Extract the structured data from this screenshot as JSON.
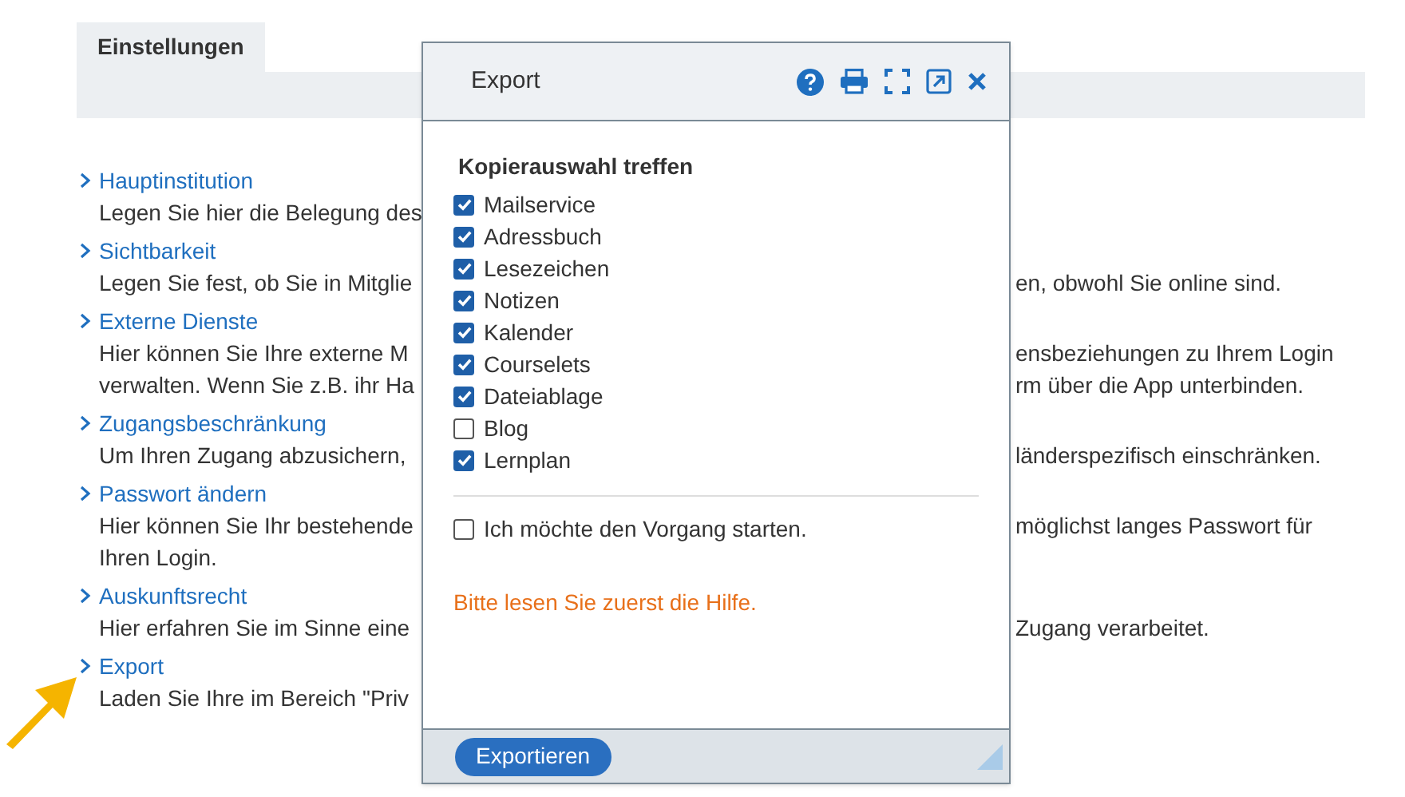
{
  "page_tab": "Einstellungen",
  "items": [
    {
      "title": "Hauptinstitution",
      "lines": [
        {
          "left": "Legen Sie hier die Belegung des"
        }
      ]
    },
    {
      "title": "Sichtbarkeit",
      "lines": [
        {
          "left": "Legen Sie fest, ob Sie in Mitglie",
          "right": "en, obwohl Sie online sind."
        }
      ]
    },
    {
      "title": "Externe Dienste",
      "lines": [
        {
          "left": "Hier können Sie Ihre externe M",
          "right": "ensbeziehungen zu Ihrem Login"
        },
        {
          "left": "verwalten. Wenn Sie z.B. ihr Ha",
          "right": "rm über die App unterbinden."
        }
      ]
    },
    {
      "title": "Zugangsbeschränkung",
      "lines": [
        {
          "left": "Um Ihren Zugang abzusichern,",
          "right": "länderspezifisch einschränken."
        }
      ]
    },
    {
      "title": "Passwort ändern",
      "lines": [
        {
          "left": "Hier können Sie Ihr bestehende",
          "right": "möglichst langes Passwort für"
        },
        {
          "left": "Ihren Login."
        }
      ]
    },
    {
      "title": "Auskunftsrecht",
      "lines": [
        {
          "left": "Hier erfahren Sie im Sinne eine",
          "right": "Zugang verarbeitet."
        }
      ]
    },
    {
      "title": "Export",
      "lines": [
        {
          "left": "Laden Sie Ihre im Bereich \"Priv"
        }
      ]
    }
  ],
  "dialog": {
    "title": "Export",
    "heading": "Kopierauswahl treffen",
    "options": [
      {
        "label": "Mailservice",
        "checked": true
      },
      {
        "label": "Adressbuch",
        "checked": true
      },
      {
        "label": "Lesezeichen",
        "checked": true
      },
      {
        "label": "Notizen",
        "checked": true
      },
      {
        "label": "Kalender",
        "checked": true
      },
      {
        "label": "Courselets",
        "checked": true
      },
      {
        "label": "Dateiablage",
        "checked": true
      },
      {
        "label": "Blog",
        "checked": false
      },
      {
        "label": "Lernplan",
        "checked": true
      }
    ],
    "confirm": {
      "label": "Ich möchte den Vorgang starten.",
      "checked": false
    },
    "hint": "Bitte lesen Sie zuerst die Hilfe.",
    "button": "Exportieren"
  }
}
